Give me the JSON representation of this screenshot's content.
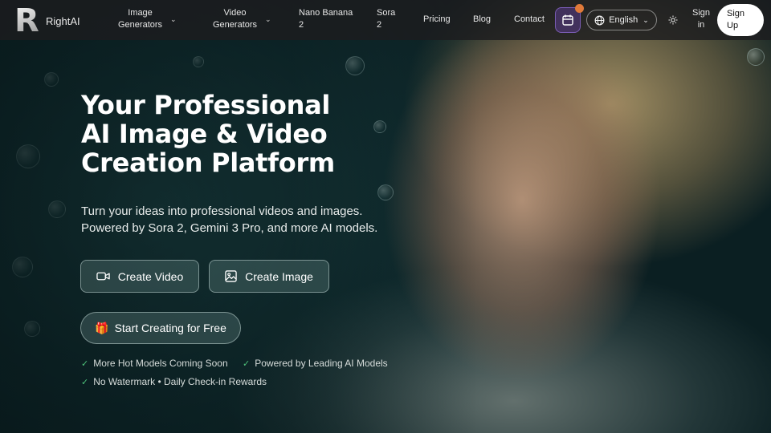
{
  "brand": {
    "name": "RightAI",
    "logo_letter": "R"
  },
  "nav": {
    "items": [
      {
        "label_line1": "Image",
        "label_line2": "Generators",
        "has_dropdown": true
      },
      {
        "label_line1": "Video",
        "label_line2": "Generators",
        "has_dropdown": true
      },
      {
        "label_line1": "Nano Banana",
        "label_line2": "2",
        "has_dropdown": false
      },
      {
        "label_line1": "Sora",
        "label_line2": "2",
        "has_dropdown": false
      },
      {
        "label_line1": "Pricing",
        "label_line2": "",
        "has_dropdown": false
      },
      {
        "label_line1": "Blog",
        "label_line2": "",
        "has_dropdown": false
      },
      {
        "label_line1": "Contact",
        "label_line2": "",
        "has_dropdown": false
      }
    ],
    "checkin_icon": "calendar-icon",
    "language": "English",
    "theme_icon": "sun-icon",
    "signin_line1": "Sign",
    "signin_line2": "in",
    "signup_line1": "Sign",
    "signup_line2": "Up"
  },
  "hero": {
    "title_line1": "Your Professional",
    "title_line2": "AI Image & Video",
    "title_line3": "Creation Platform",
    "subtitle_line1": "Turn your ideas into professional videos and images.",
    "subtitle_line2": "Powered by Sora 2, Gemini 3 Pro, and more AI models.",
    "create_video": "Create Video",
    "create_image": "Create Image",
    "start_free": "Start Creating for Free",
    "features": [
      "More Hot Models Coming Soon",
      "Powered by Leading AI Models",
      "No Watermark • Daily Check-in Rewards"
    ]
  },
  "colors": {
    "header_bg": "#1c1c1e",
    "accent_check": "#4ec27a",
    "notification_dot": "#e07a3a",
    "checkin_btn": "#5a3c8c"
  }
}
